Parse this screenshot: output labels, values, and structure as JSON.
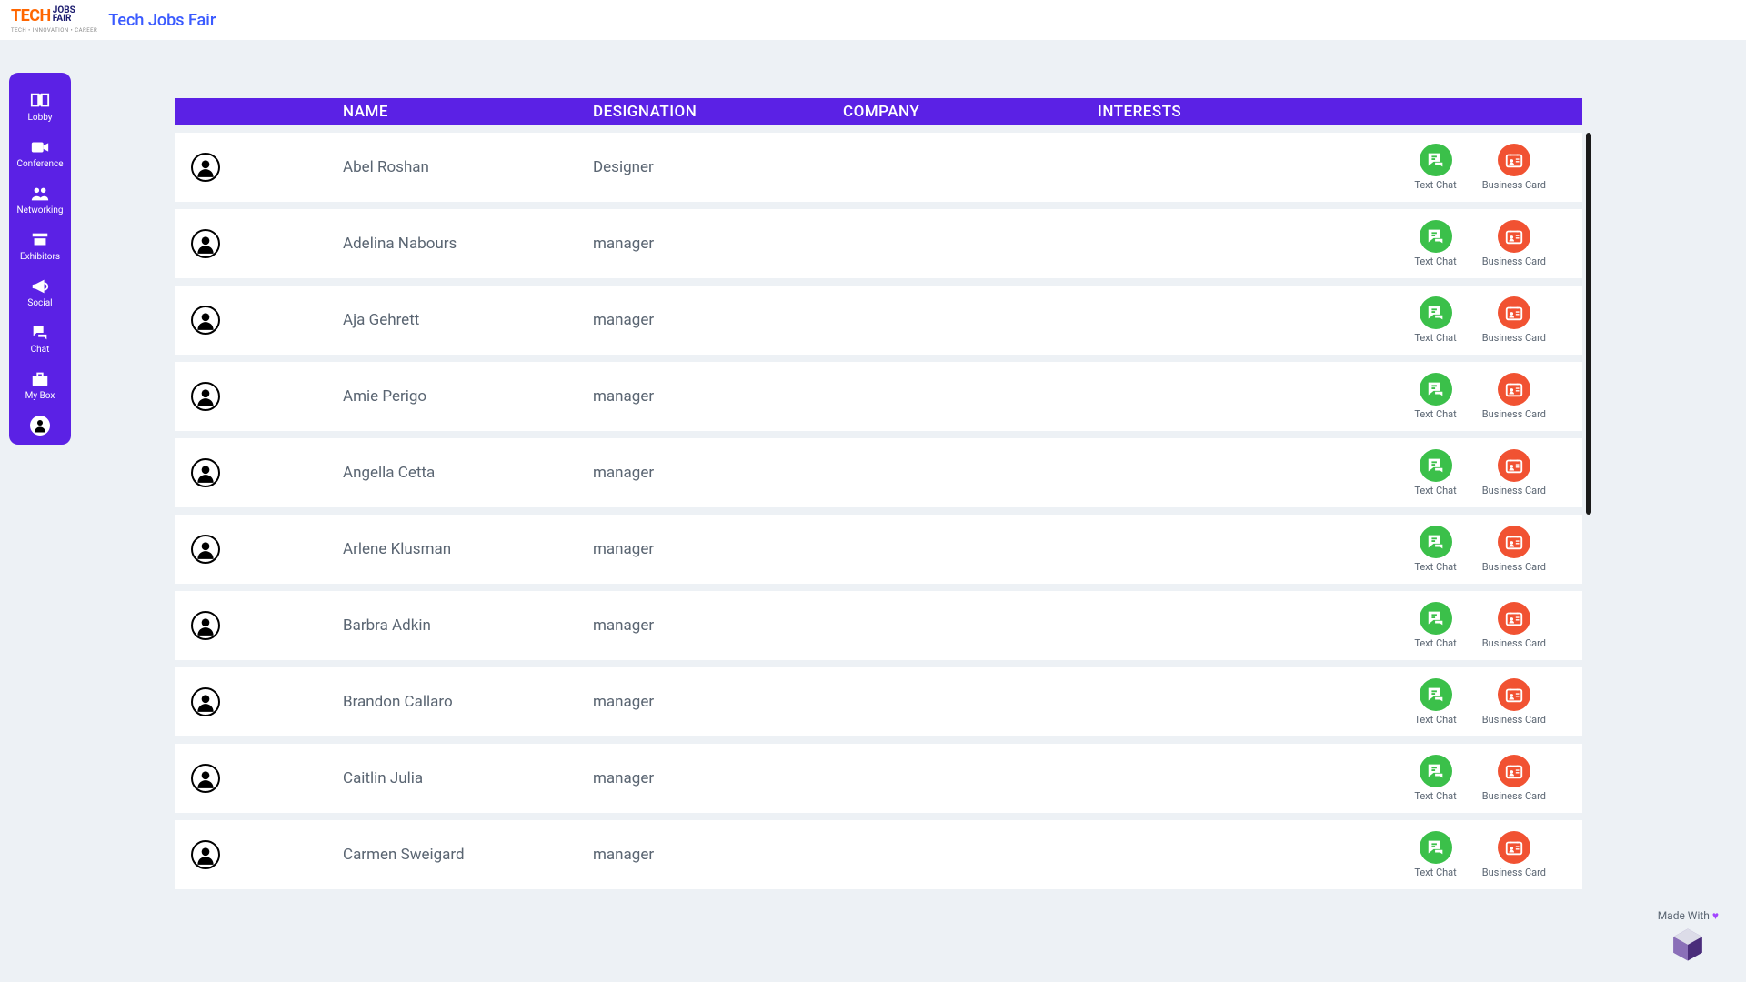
{
  "header": {
    "title": "Tech Jobs Fair"
  },
  "sidebar": {
    "items": [
      {
        "label": "Lobby"
      },
      {
        "label": "Conference"
      },
      {
        "label": "Networking"
      },
      {
        "label": "Exhibitors"
      },
      {
        "label": "Social"
      },
      {
        "label": "Chat"
      },
      {
        "label": "My Box"
      }
    ]
  },
  "table": {
    "headers": {
      "name": "NAME",
      "designation": "DESIGNATION",
      "company": "COMPANY",
      "interests": "INTERESTS"
    },
    "action_labels": {
      "chat": "Text Chat",
      "card": "Business Card"
    },
    "rows": [
      {
        "name": "Abel Roshan",
        "designation": "Designer",
        "company": "",
        "interests": ""
      },
      {
        "name": "Adelina Nabours",
        "designation": "manager",
        "company": "",
        "interests": ""
      },
      {
        "name": "Aja Gehrett",
        "designation": "manager",
        "company": "",
        "interests": ""
      },
      {
        "name": "Amie Perigo",
        "designation": "manager",
        "company": "",
        "interests": ""
      },
      {
        "name": "Angella Cetta",
        "designation": "manager",
        "company": "",
        "interests": ""
      },
      {
        "name": "Arlene Klusman",
        "designation": "manager",
        "company": "",
        "interests": ""
      },
      {
        "name": "Barbra Adkin",
        "designation": "manager",
        "company": "",
        "interests": ""
      },
      {
        "name": "Brandon Callaro",
        "designation": "manager",
        "company": "",
        "interests": ""
      },
      {
        "name": "Caitlin Julia",
        "designation": "manager",
        "company": "",
        "interests": ""
      },
      {
        "name": "Carmen Sweigard",
        "designation": "manager",
        "company": "",
        "interests": ""
      }
    ]
  },
  "footer": {
    "made_with": "Made With "
  }
}
